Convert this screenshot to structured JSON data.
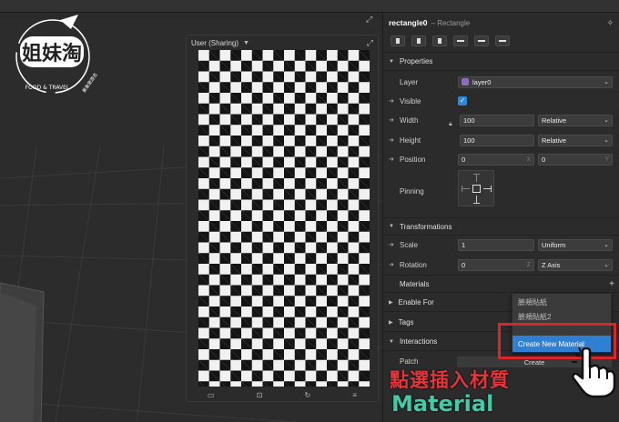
{
  "logo": {
    "brand": "姐妹淘",
    "tagline": "FOOD & TRAVEL",
    "badge": "美食旅游志"
  },
  "simulator": {
    "device_label": "User (Sharing)"
  },
  "inspector": {
    "object_name": "rectangle0",
    "object_type": "– Rectangle",
    "sections": {
      "properties": "Properties",
      "transformations": "Transformations",
      "materials": "Materials",
      "enable_for": "Enable For",
      "tags": "Tags",
      "interactions": "Interactions"
    },
    "layer": {
      "label": "Layer",
      "value": "layer0",
      "swatch_color": "#8a6fc0"
    },
    "visible": {
      "label": "Visible",
      "checked": true
    },
    "width": {
      "label": "Width",
      "value": "100",
      "unit": "Relative"
    },
    "height": {
      "label": "Height",
      "value": "100",
      "unit": "Relative"
    },
    "position": {
      "label": "Position",
      "x": "0",
      "y": "0",
      "x_axis": "X",
      "y_axis": "Y"
    },
    "pinning": {
      "label": "Pinning"
    },
    "scale": {
      "label": "Scale",
      "value": "1",
      "mode": "Uniform"
    },
    "rotation": {
      "label": "Rotation",
      "value": "0",
      "axis_symbol": "Z",
      "axis": "Z Axis"
    },
    "patch": {
      "label": "Patch",
      "button": "Create"
    }
  },
  "material_menu": {
    "items": [
      "臉頰貼紙",
      "臉頰貼紙2",
      "Create New Material"
    ]
  },
  "caption": {
    "line1": "點選插入材質",
    "line2": "Material"
  },
  "colors": {
    "accent": "#2f7fd3",
    "highlight_red": "#d8262b",
    "caption_red": "#e5343a",
    "caption_green": "#45c9a6"
  }
}
